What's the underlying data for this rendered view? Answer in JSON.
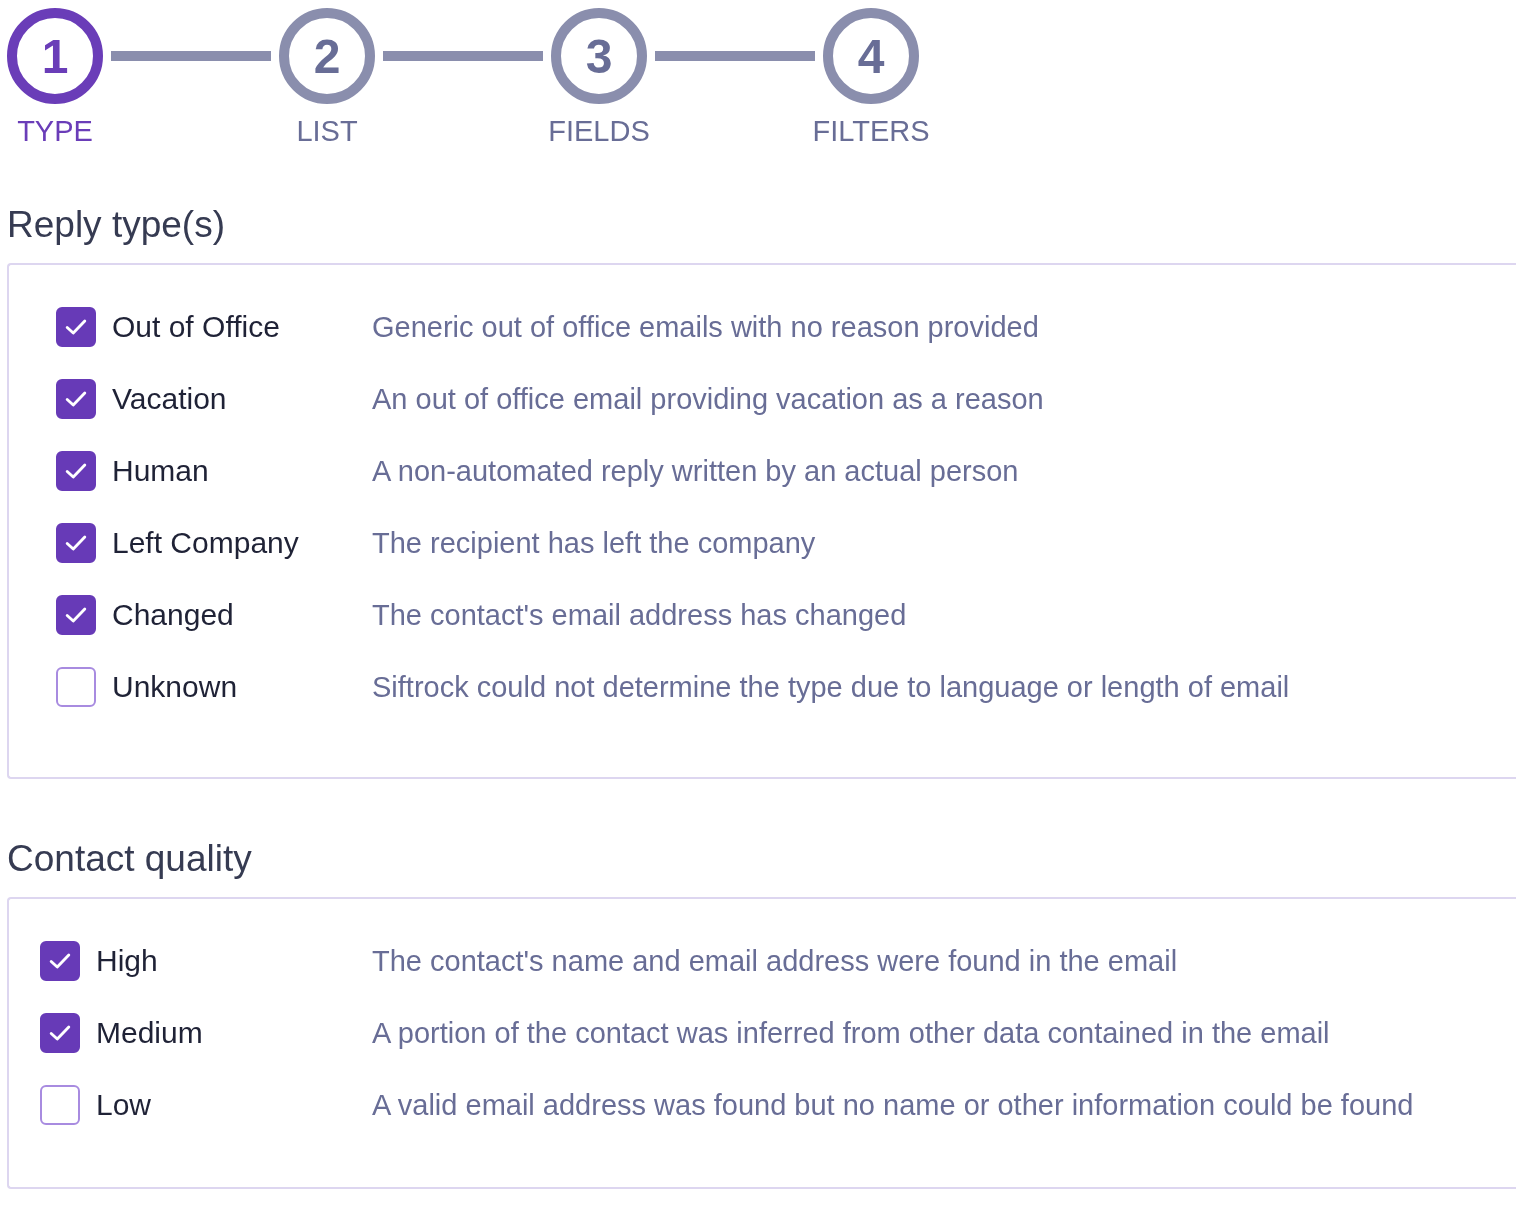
{
  "steps": [
    {
      "number": "1",
      "label": "TYPE",
      "selected": true
    },
    {
      "number": "2",
      "label": "LIST",
      "selected": false
    },
    {
      "number": "3",
      "label": "FIELDS",
      "selected": false
    },
    {
      "number": "4",
      "label": "FILTERS",
      "selected": false
    }
  ],
  "sections": [
    {
      "title": "Reply type(s)",
      "options": [
        {
          "label": "Out of Office",
          "description": "Generic out of office emails with no reason provided",
          "checked": true
        },
        {
          "label": "Vacation",
          "description": "An out of office email providing vacation as a reason",
          "checked": true
        },
        {
          "label": "Human",
          "description": "A non-automated reply written by an actual person",
          "checked": true
        },
        {
          "label": "Left Company",
          "description": "The recipient has left the company",
          "checked": true
        },
        {
          "label": "Changed",
          "description": "The contact's email address has changed",
          "checked": true
        },
        {
          "label": "Unknown",
          "description": "Siftrock could not determine the type due to language or length of email",
          "checked": false
        }
      ]
    },
    {
      "title": "Contact quality",
      "options": [
        {
          "label": "High",
          "description": "The contact's name and email address were found in the email",
          "checked": true
        },
        {
          "label": "Medium",
          "description": "A portion of the contact was inferred from other data contained in the email",
          "checked": true
        },
        {
          "label": "Low",
          "description": "A valid email address was found but no name or other information could be found",
          "checked": false
        }
      ]
    }
  ]
}
